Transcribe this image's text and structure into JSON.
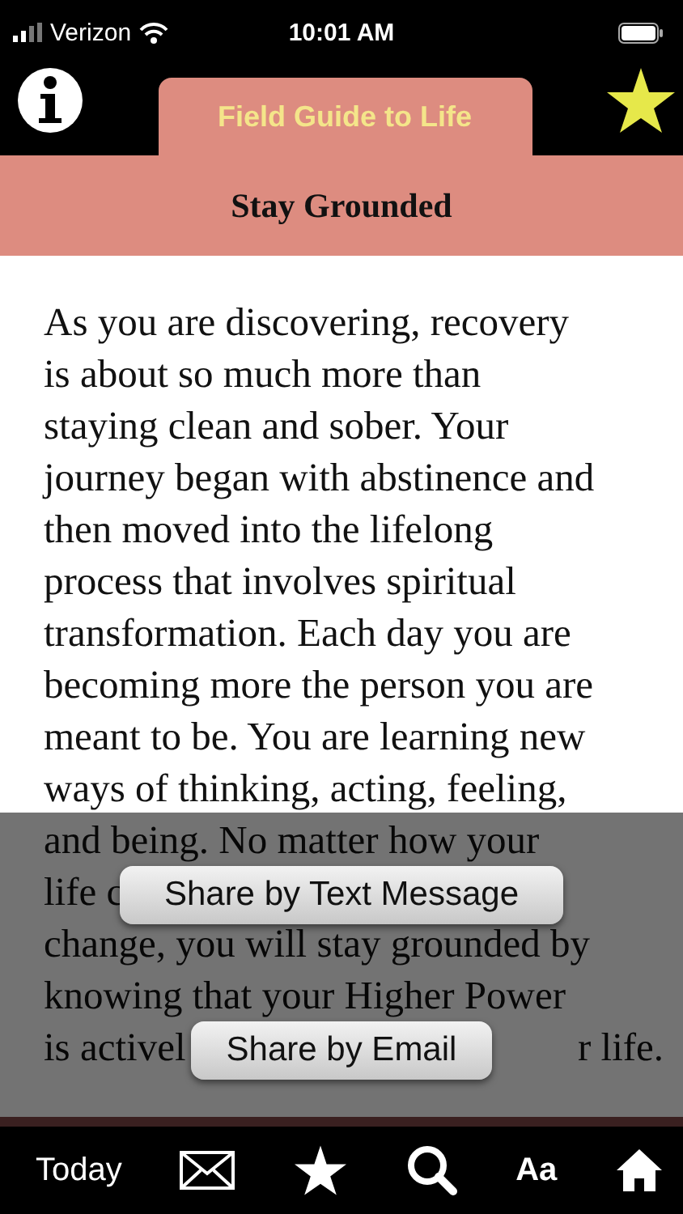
{
  "status_bar": {
    "carrier": "Verizon",
    "time": "10:01 AM"
  },
  "header": {
    "tab": "Field Guide to Life",
    "title": "Stay Grounded"
  },
  "body": {
    "lines": [
      {
        "text": "As you are discovering, recovery"
      },
      {
        "text": "is about so much more than"
      },
      {
        "text": "staying clean and sober. Your"
      },
      {
        "text": "journey began with abstinence and"
      },
      {
        "text": "then moved into the lifelong"
      },
      {
        "text": "process that involves spiritual"
      },
      {
        "text": "transformation. Each day you are"
      },
      {
        "text": "becoming more the person you are"
      },
      {
        "text": "meant to be. You are learning new"
      },
      {
        "text": "ways of thinking, acting, feeling,"
      },
      {
        "text": "and being. No matter how your"
      },
      {
        "text": "life c"
      },
      {
        "text": "change, you will stay grounded by"
      },
      {
        "text": "knowing that your Higher Power"
      },
      {
        "text": "is activel",
        "after": "r life."
      }
    ]
  },
  "share_buttons": [
    "Share by Text Message",
    "Share by Email"
  ],
  "tab_bar": [
    {
      "kind": "text",
      "label": "Today"
    },
    {
      "kind": "mail"
    },
    {
      "kind": "star"
    },
    {
      "kind": "search"
    },
    {
      "kind": "text",
      "label": "Aa"
    },
    {
      "kind": "home"
    }
  ]
}
